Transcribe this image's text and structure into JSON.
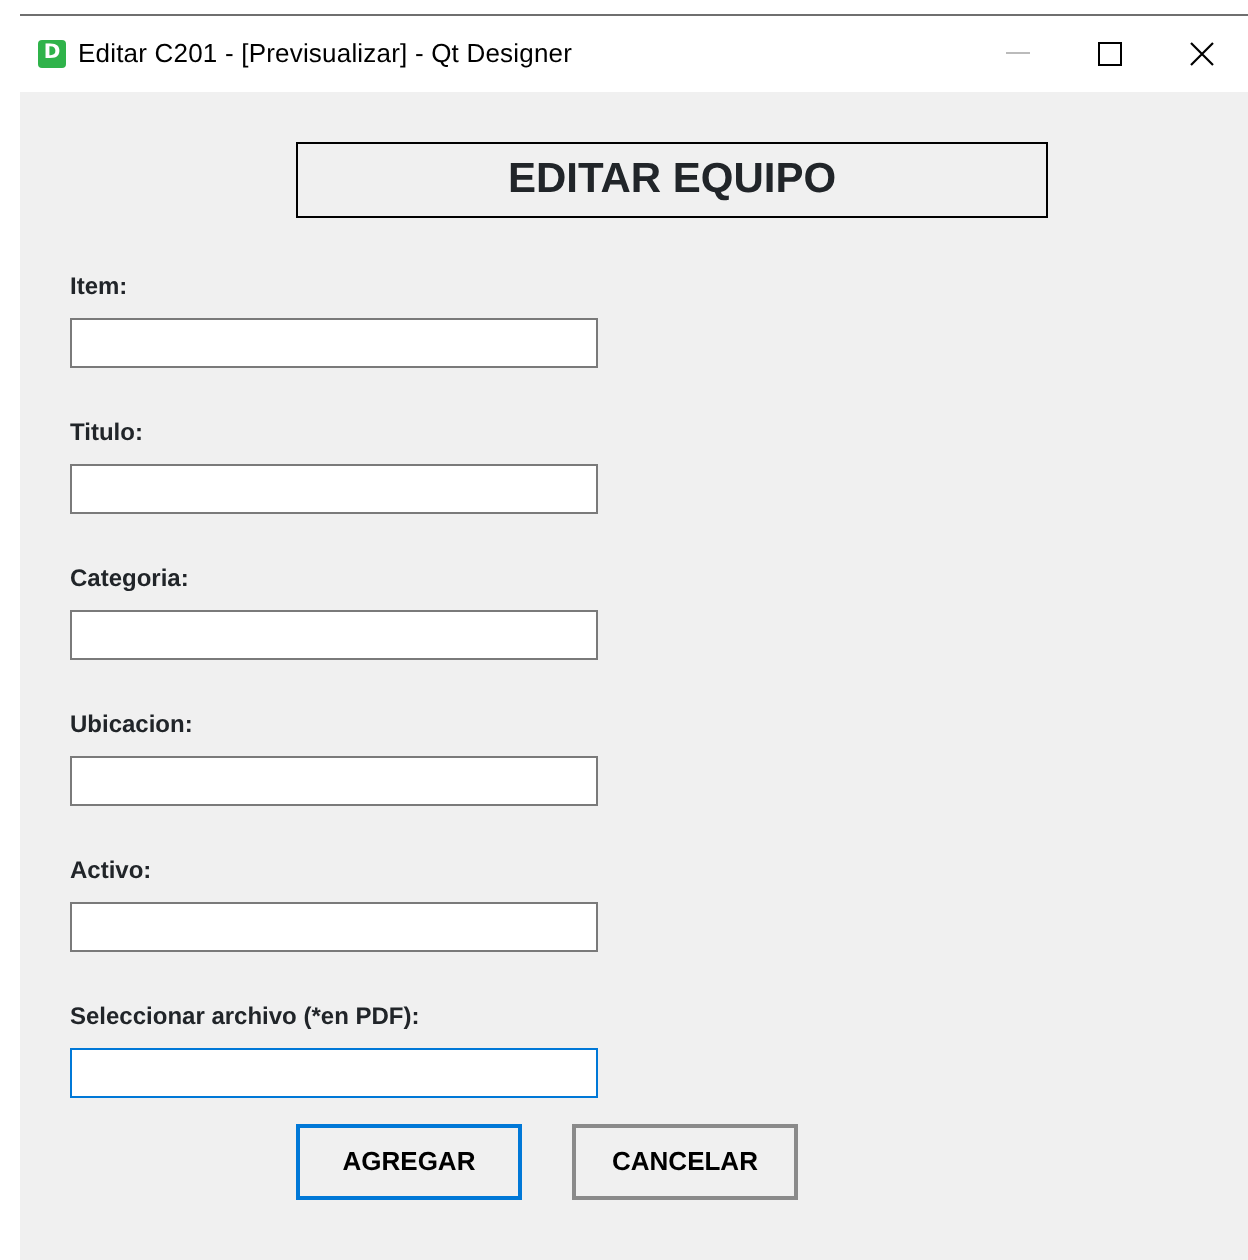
{
  "window": {
    "title": "Editar C201 - [Previsualizar] - Qt Designer",
    "app_icon_letter": "D"
  },
  "heading": "EDITAR EQUIPO",
  "fields": [
    {
      "label": "Item:",
      "focused": false
    },
    {
      "label": "Titulo:",
      "focused": false
    },
    {
      "label": "Categoria:",
      "focused": false
    },
    {
      "label": "Ubicacion:",
      "focused": false
    },
    {
      "label": "Activo:",
      "focused": false
    },
    {
      "label": "Seleccionar archivo (*en PDF):",
      "focused": true
    }
  ],
  "buttons": [
    {
      "label": "AGREGAR",
      "default": true
    },
    {
      "label": "CANCELAR",
      "default": false
    }
  ]
}
